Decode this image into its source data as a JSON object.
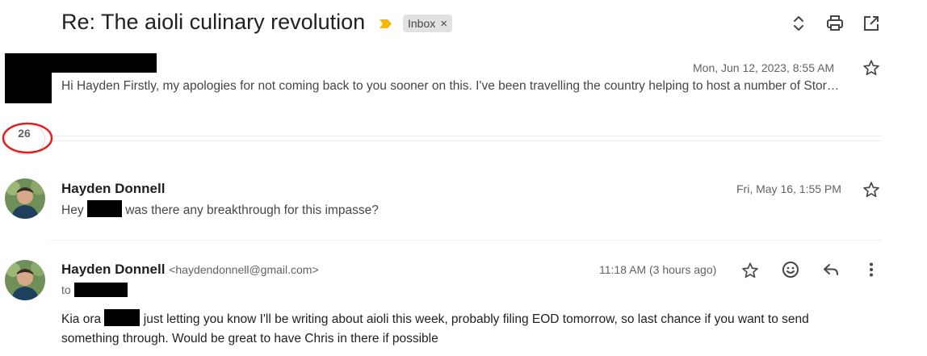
{
  "subject": "Re: The aioli culinary revolution",
  "label": "Inbox",
  "label_remove": "×",
  "collapsed_count": "26",
  "message1": {
    "date": "Mon, Jun 12, 2023, 8:55 AM",
    "snippet": "Hi Hayden Firstly, my apologies for not coming back to you sooner on this. I've been travelling the country helping to host a number of Stor…"
  },
  "message2": {
    "sender": "Hayden Donnell",
    "date": "Fri, May 16, 1:55 PM",
    "snippet_start": "Hey",
    "snippet_end": "was there any breakthrough for this impasse?"
  },
  "message3": {
    "sender": "Hayden Donnell",
    "email": "<haydendonnell@gmail.com>",
    "date": "11:18 AM (3 hours ago)",
    "to_label": "to",
    "body_start": "Kia ora",
    "body_line1_rest": "just letting you know I'll be writing about aioli this week, probably filing EOD tomorrow, so last chance if you want to send",
    "body_line2": "something through. Would be great to have Chris in there if possible"
  },
  "icons": {
    "expand": "unfold-icon",
    "print": "print-icon",
    "popout": "open-in-new-icon",
    "star": "star-outline-icon",
    "emoji": "emoji-icon",
    "reply": "reply-icon",
    "more": "more-vert-icon"
  },
  "colors": {
    "importance": "#f2b900",
    "annotation": "#e02020"
  }
}
